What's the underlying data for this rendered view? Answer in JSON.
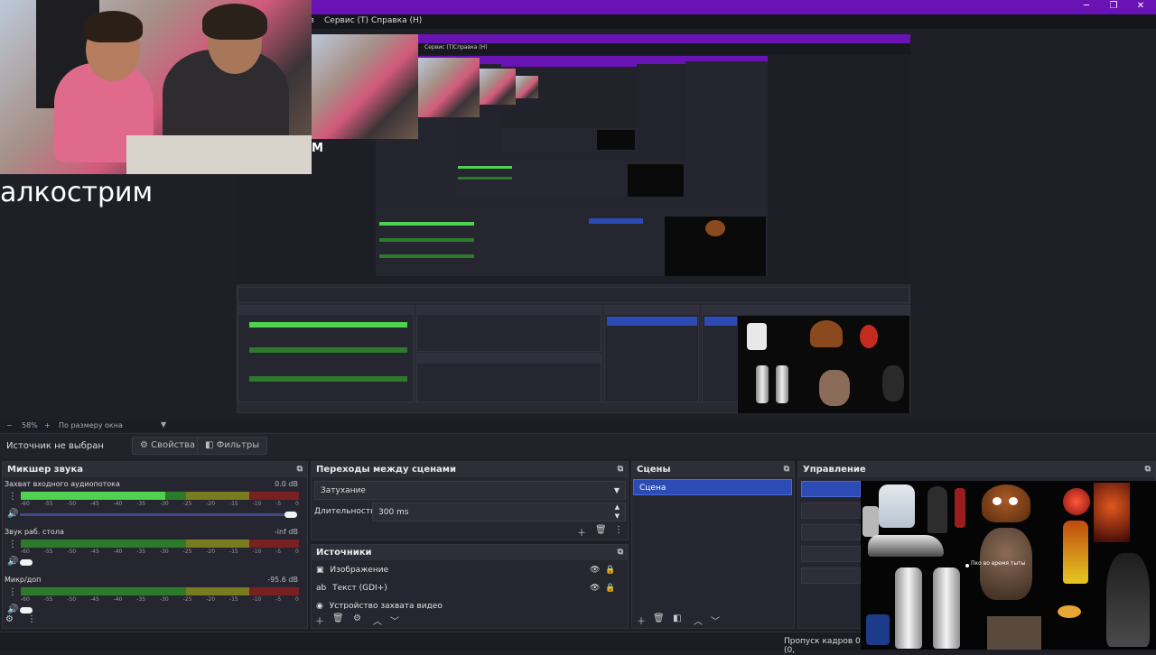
{
  "menu": {
    "service": "Сервис (Т)",
    "help": "Справка (Н)",
    "char_fragment": "з"
  },
  "preview": {
    "stream_title": "алкострим",
    "cam_label": "М",
    "nested_menu_service": "Сервис (Т)",
    "nested_menu_help": "Справка (Н)"
  },
  "zoombar": {
    "minus": "−",
    "zoom_value": "58%",
    "plus": "+",
    "fit_label": "По размеру окна"
  },
  "source_bar": {
    "no_source": "Источник не выбран",
    "properties": "Свойства",
    "filters": "Фильтры"
  },
  "mixer": {
    "title": "Микшер звука",
    "channels": [
      {
        "name": "Захват входного аудиопотока",
        "db": "0.0 dB",
        "level": 0.52
      },
      {
        "name": "Звук раб. стола",
        "db": "-inf dB",
        "level": 0.0
      },
      {
        "name": "Микр/доп",
        "db": "-95.6 dB",
        "level": 0.0
      }
    ],
    "ticks": [
      "-60",
      "-55",
      "-50",
      "-45",
      "-40",
      "-35",
      "-30",
      "-25",
      "-20",
      "-15",
      "-10",
      "-5",
      "0"
    ]
  },
  "transitions": {
    "title": "Переходы между сценами",
    "selected": "Затухание",
    "duration_label": "Длительность",
    "duration_value": "300 ms"
  },
  "sources": {
    "title": "Источники",
    "items": [
      {
        "label": "Изображение",
        "icon": "image-icon"
      },
      {
        "label": "Текст (GDI+)",
        "icon": "text-icon"
      },
      {
        "label": "Устройство захвата видео",
        "icon": "camera-icon"
      }
    ]
  },
  "scenes": {
    "title": "Сцены",
    "items": [
      "Сцена"
    ]
  },
  "controls": {
    "title": "Управление"
  },
  "collage": {
    "caption": "Пко во время тыты"
  },
  "status": {
    "dropped_frames": "Пропуск кадров 0 (0,"
  }
}
